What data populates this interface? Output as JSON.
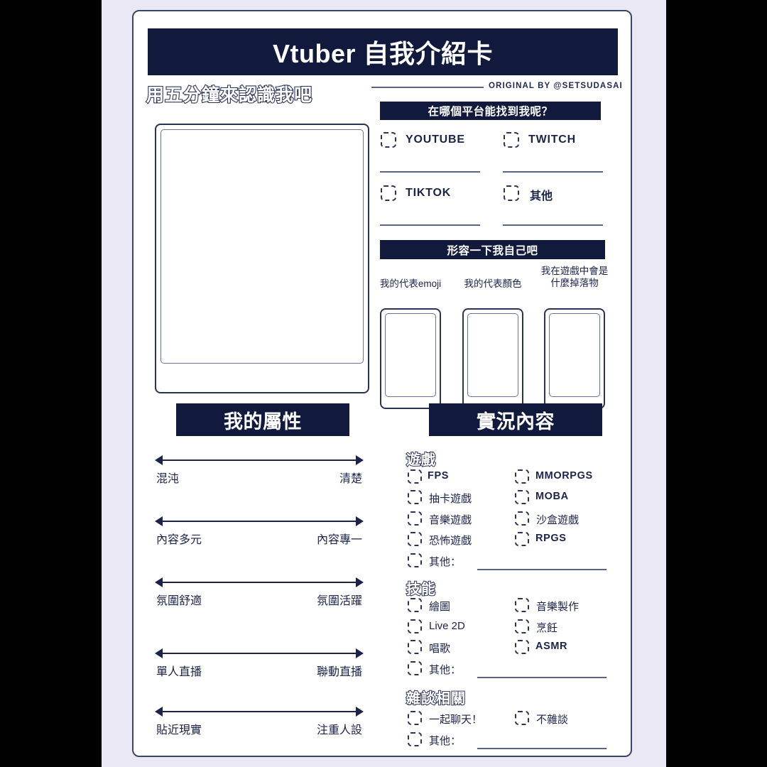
{
  "header": {
    "title": "Vtuber 自我介紹卡",
    "subtitle": "用五分鐘來認識我吧",
    "credit": "ORIGINAL BY @SETSUDASAI"
  },
  "theme": {
    "navy": "#111a3c",
    "ink": "#1b2448",
    "outline": "#2b3354",
    "rule": "#5a6483",
    "page_bg": "#eae8f4",
    "card_bg": "#ffffff"
  },
  "photo": {
    "caption": ""
  },
  "platform": {
    "bar_label": "在哪個平台能找到我呢？",
    "options": [
      {
        "label": "YOUTUBE",
        "cjk": false
      },
      {
        "label": "TWITCH",
        "cjk": false
      },
      {
        "label": "TIKTOK",
        "cjk": false
      },
      {
        "label": "其他",
        "cjk": true
      }
    ]
  },
  "describe": {
    "bar_label": "形容一下我自己吧",
    "cards": [
      {
        "caption": "我的代表emoji"
      },
      {
        "caption": "我的代表顏色"
      },
      {
        "caption": "我在遊戲中會是\n什麼掉落物"
      }
    ]
  },
  "attributes": {
    "bar_label": "我的屬性",
    "sliders": [
      {
        "left": "混沌",
        "right": "清楚"
      },
      {
        "left": "內容多元",
        "right": "內容專一"
      },
      {
        "left": "氛圍舒適",
        "right": "氛圍活躍"
      },
      {
        "left": "單人直播",
        "right": "聯動直播"
      },
      {
        "left": "貼近現實",
        "right": "注重人設"
      }
    ]
  },
  "stream": {
    "bar_label": "實況內容",
    "groups": [
      {
        "heading": "遊戲",
        "col_left": [
          "FPS",
          "抽卡遊戲",
          "音樂遊戲",
          "恐怖遊戲"
        ],
        "col_right": [
          "MMORPGS",
          "MOBA",
          "沙盒遊戲",
          "RPGS"
        ],
        "other_label": "其他："
      },
      {
        "heading": "技能",
        "col_left": [
          "繪圖",
          "Live 2D",
          "唱歌"
        ],
        "col_right": [
          "音樂製作",
          "烹飪",
          "ASMR"
        ],
        "other_label": "其他："
      },
      {
        "heading": "雜談相關",
        "col_left": [
          "一起聊天！"
        ],
        "col_right": [
          "不雜談"
        ],
        "other_label": "其他："
      }
    ]
  }
}
